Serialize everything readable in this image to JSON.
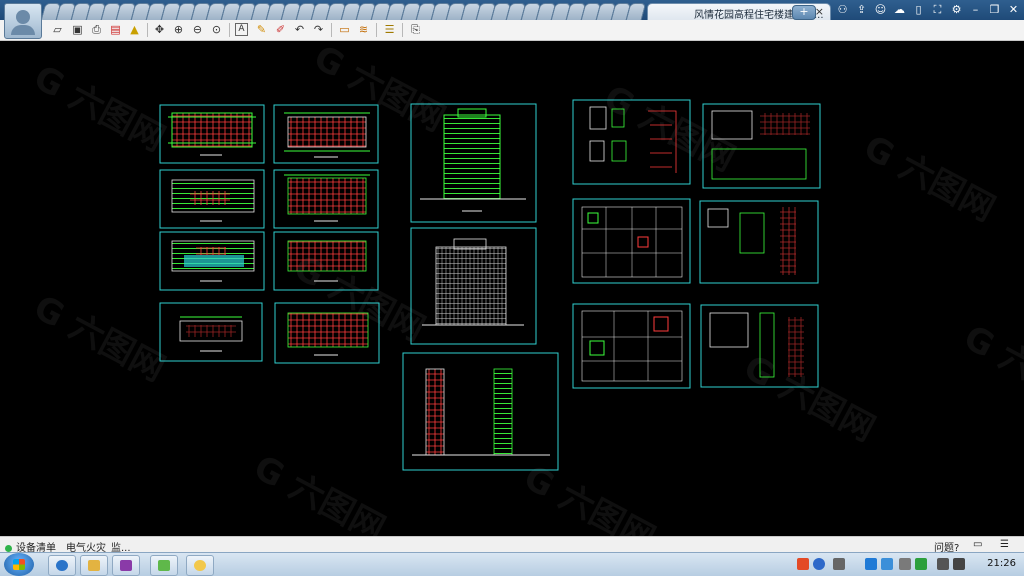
{
  "window": {
    "active_tab_title": "风情花园高程住宅楼建筑施...",
    "close_tab_glyph": "×",
    "new_tab_glyph": "+"
  },
  "toolbar_icons": [
    "open-icon",
    "save-icon",
    "print-icon",
    "pdf-icon",
    "lock-icon",
    "pan-icon",
    "zoom-in-icon",
    "zoom-out-icon",
    "zoom-window-icon",
    "text-icon",
    "pencil-icon",
    "eraser-icon",
    "undo-icon",
    "redo-icon",
    "measure-icon",
    "layers-icon",
    "stack-icon",
    "export-icon"
  ],
  "task_strip": {
    "item1": "设备清单",
    "item2": "电气火灾_监...",
    "help": "问题?"
  },
  "tray": {
    "clock": "21:26"
  },
  "colors": {
    "canvas": "#000000",
    "sheet_border": "#2fd0d0",
    "cad_green": "#3dff3d",
    "cad_red": "#ff3b3b",
    "cad_white": "#e8e8e8"
  }
}
